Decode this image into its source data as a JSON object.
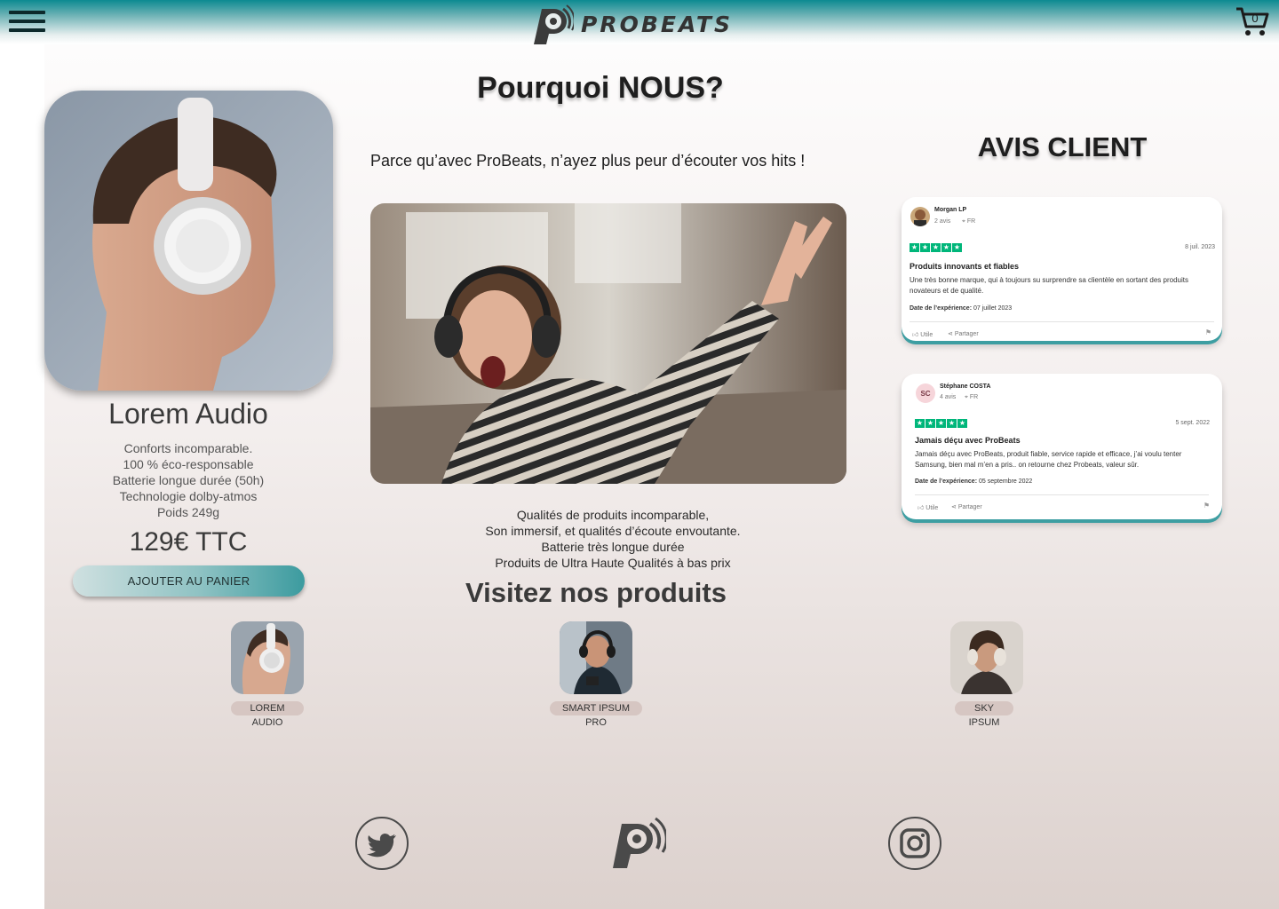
{
  "header": {
    "brand_name": "PROBEATS",
    "menu_icon": "hamburger-menu-icon",
    "cart_icon": "shopping-cart-icon",
    "cart_count": "0"
  },
  "featured_product": {
    "name": "Lorem Audio",
    "specs": [
      "Conforts incomparable.",
      "100 % éco-responsable",
      "Batterie longue durée (50h)",
      "Technologie dolby-atmos",
      "Poids 249g"
    ],
    "price": "129€ TTC",
    "add_to_cart_label": "AJOUTER AU PANIER"
  },
  "why": {
    "title": "Pourquoi NOUS?",
    "subtitle": "Parce qu’avec ProBeats, n’ayez plus peur d’écouter vos hits !",
    "qualities": [
      "Qualités de produits incomparable,",
      "Son immersif, et qualités d’écoute envoutante.",
      "Batterie très longue durée",
      "Produits de Ultra Haute Qualités à bas prix"
    ]
  },
  "reviews": {
    "title": "AVIS CLIENT",
    "items": [
      {
        "author": "Morgan LP",
        "count": "2 avis",
        "country": "FR",
        "date": "8 juil. 2023",
        "title": "Produits innovants et fiables",
        "text": "Une très bonne marque, qui à toujours su surprendre sa clientèle en sortant des produits novateurs et de qualité.",
        "experience_label": "Date de l’expérience:",
        "experience_date": "07 juillet 2023",
        "useful": "Utile",
        "share": "Partager",
        "rating": 5
      },
      {
        "author": "Stéphane COSTA",
        "initials": "SC",
        "count": "4 avis",
        "country": "FR",
        "date": "5 sept. 2022",
        "title": "Jamais déçu avec ProBeats",
        "text": "Jamais déçu avec ProBeats, produit fiable, service rapide et efficace, j’ai voulu tenter Samsung, bien mal m’en a pris.. on retourne chez Probeats, valeur sûr.",
        "experience_label": "Date de l’expérience:",
        "experience_date": "05 septembre 2022",
        "useful": "Utile",
        "share": "Partager",
        "rating": 5
      }
    ]
  },
  "products": {
    "title": "Visitez nos produits",
    "items": [
      {
        "label": "LOREM AUDIO"
      },
      {
        "label": "SMART IPSUM PRO"
      },
      {
        "label": "SKY IPSUM"
      }
    ]
  },
  "footer": {
    "icons": [
      "twitter-icon",
      "probeats-logo-icon",
      "instagram-icon"
    ]
  },
  "colors": {
    "accent": "#3c9b9f",
    "header_top": "#0c8a91",
    "label_bg": "#d6c6c2",
    "star_green": "#00b67a"
  }
}
